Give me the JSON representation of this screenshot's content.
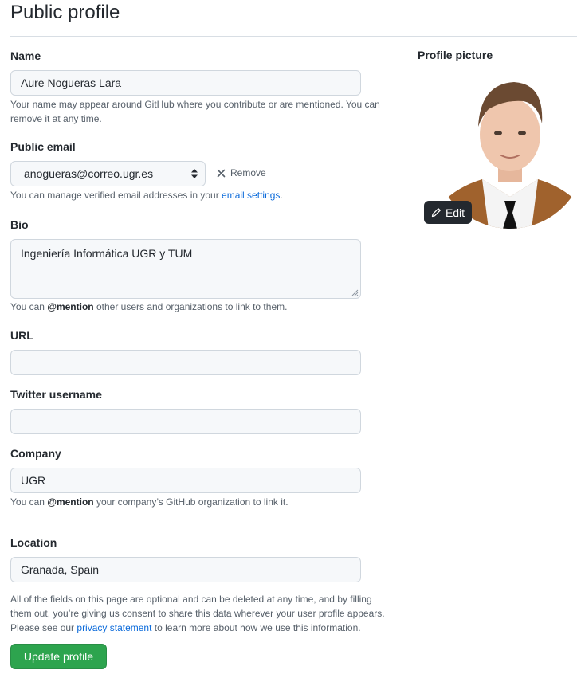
{
  "page": {
    "title": "Public profile"
  },
  "name": {
    "label": "Name",
    "value": "Aure Nogueras Lara",
    "note_line1": "Your name may appear around GitHub where you contribute or are mentioned. You can",
    "note_line2": "remove it at any time."
  },
  "email": {
    "label": "Public email",
    "value": "anogueras@correo.ugr.es",
    "remove_label": "Remove",
    "note_prefix": "You can manage verified email addresses in your ",
    "note_link": "email settings",
    "note_suffix": "."
  },
  "bio": {
    "label": "Bio",
    "value": "Ingeniería Informática UGR y TUM",
    "note_prefix": "You can ",
    "note_bold": "@mention",
    "note_suffix": " other users and organizations to link to them."
  },
  "url": {
    "label": "URL",
    "value": ""
  },
  "twitter": {
    "label": "Twitter username",
    "value": ""
  },
  "company": {
    "label": "Company",
    "value": "UGR",
    "note_prefix": "You can ",
    "note_bold": "@mention",
    "note_suffix": " your company’s GitHub organization to link it."
  },
  "location": {
    "label": "Location",
    "value": "Granada, Spain"
  },
  "consent": {
    "line1": "All of the fields on this page are optional and can be deleted at any time, and by filling",
    "line2": "them out, you’re giving us consent to share this data wherever your user profile appears.",
    "line3_prefix": "Please see our ",
    "line3_link": "privacy statement",
    "line3_suffix": " to learn more about how we use this information."
  },
  "actions": {
    "update_label": "Update profile"
  },
  "profile_picture": {
    "label": "Profile picture",
    "edit_label": "Edit"
  },
  "colors": {
    "primary_button": "#2da44e",
    "link": "#0969da",
    "edit_button": "#24292f"
  }
}
